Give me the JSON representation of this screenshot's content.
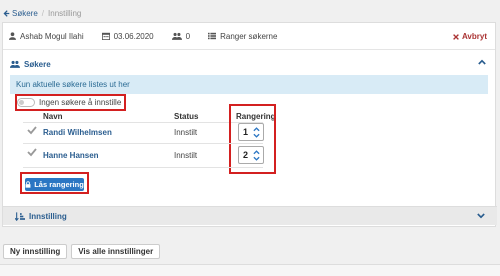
{
  "breadcrumb": {
    "back_label": "Søkere",
    "current": "Innstilling"
  },
  "infobar": {
    "user": "Ashab Mogul Ilahi",
    "date": "03.06.2020",
    "count": "0",
    "action": "Ranger søkerne",
    "cancel_label": "Avbryt"
  },
  "panel": {
    "title": "Søkere",
    "alert": "Kun aktuelle søkere listes ut her",
    "toggle_label": "Ingen søkere å innstille",
    "columns": {
      "name": "Navn",
      "status": "Status",
      "rank": "Rangering"
    },
    "rows": [
      {
        "name": "Randi Wilhelmsen",
        "status": "Innstilt",
        "rank": "1"
      },
      {
        "name": "Hanne Hansen",
        "status": "Innstilt",
        "rank": "2"
      }
    ],
    "lock_label": "Lås rangering"
  },
  "panel2": {
    "title": "Innstilling"
  },
  "buttons": {
    "new": "Ny innstilling",
    "all": "Vis alle innstillinger"
  },
  "colors": {
    "link": "#2a5d8f",
    "primary": "#2b76c3",
    "danger": "#a33",
    "highlight": "#d32020",
    "alert_bg": "#d8ebf6"
  },
  "icons": [
    "arrow-left-icon",
    "user-icon",
    "calendar-icon",
    "users-icon",
    "list-icon",
    "close-icon",
    "chevron-up-icon",
    "chevron-down-icon",
    "check-icon",
    "lock-icon",
    "sort-icon"
  ]
}
